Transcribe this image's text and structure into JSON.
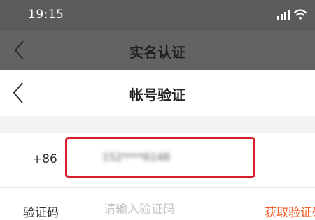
{
  "status_bar": {
    "time": "19:15",
    "signal_icon": "signal-icon",
    "wifi_icon": "wifi-icon"
  },
  "background_page": {
    "title": "实名认证",
    "back_icon": "chevron-left-icon"
  },
  "page": {
    "title": "帐号验证",
    "back_icon": "chevron-left-icon"
  },
  "phone": {
    "country_code": "+86",
    "value": "152****6148"
  },
  "code": {
    "label": "验证码",
    "placeholder": "请输入验证码",
    "get_code_label": "获取验证码"
  },
  "colors": {
    "highlight_border": "#d61f2c",
    "accent": "#f0602b"
  }
}
